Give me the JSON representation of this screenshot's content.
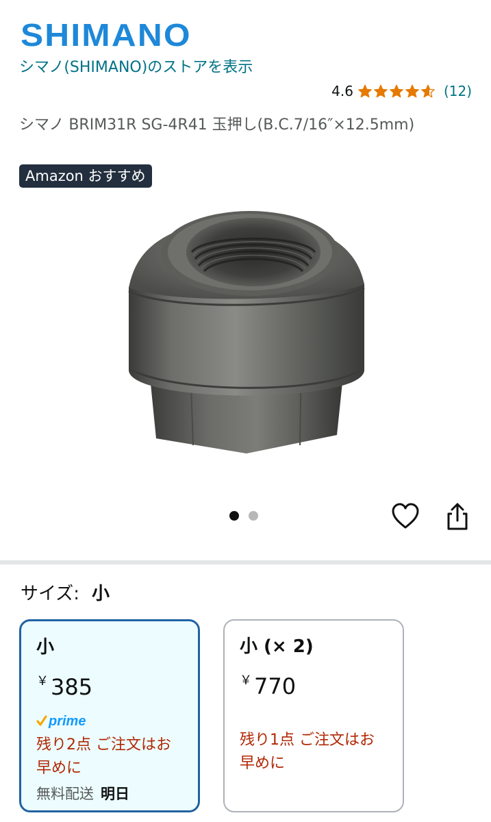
{
  "brand": {
    "logo_text": "SHIMANO",
    "color": "#1e88d9"
  },
  "store_link": "シマノ(SHIMANO)のストアを表示",
  "rating": {
    "value": "4.6",
    "stars": 4.6,
    "count": "(12)",
    "star_color": "#e67a00"
  },
  "product_title": "シマノ BRIM31R SG-4R41 玉押し(B.C.7/16″×12.5mm)",
  "badge": "Amazon おすすめ",
  "gallery": {
    "total_images": 2,
    "active_index": 0
  },
  "icons": {
    "favorite": "heart-icon",
    "share": "share-icon"
  },
  "size_selector": {
    "label": "サイズ:",
    "selected": "小",
    "options": [
      {
        "name": "小",
        "currency": "￥",
        "price": "385",
        "prime": "prime",
        "stock": "残り2点 ご注文はお早めに",
        "delivery_label": "無料配送",
        "delivery_date": "明日"
      },
      {
        "name": "小 (× 2)",
        "currency": "￥",
        "price": "770",
        "stock": "残り1点 ご注文はお早めに"
      }
    ]
  },
  "colors": {
    "link": "#007185",
    "stock_warning": "#b12704",
    "selected_border": "#2162a1",
    "prime": "#1399ff"
  }
}
